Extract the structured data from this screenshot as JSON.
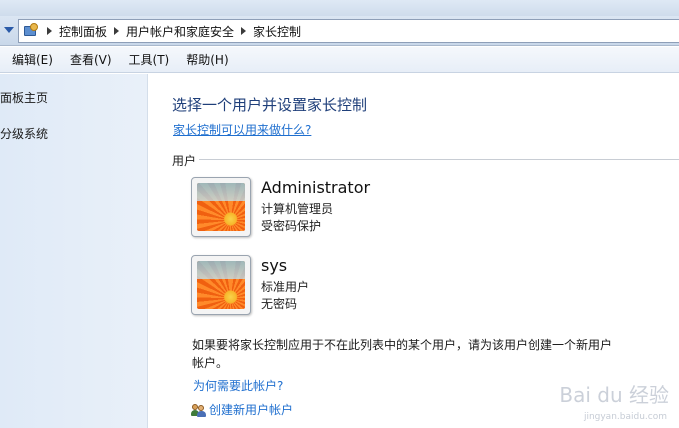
{
  "address_bar": {
    "breadcrumbs": [
      "控制面板",
      "用户帐户和家庭安全",
      "家长控制"
    ]
  },
  "menu": [
    "编辑(E)",
    "查看(V)",
    "工具(T)",
    "帮助(H)"
  ],
  "left_pane": {
    "links": [
      "面板主页",
      "分级系统"
    ]
  },
  "main": {
    "heading": "选择一个用户并设置家长控制",
    "help_link": "家长控制可以用来做什么?",
    "group_label": "用户",
    "users": [
      {
        "name": "Administrator",
        "role": "计算机管理员",
        "password": "受密码保护"
      },
      {
        "name": "sys",
        "role": "标准用户",
        "password": "无密码"
      }
    ],
    "note": "如果要将家长控制应用于不在此列表中的某个用户，请为该用户创建一个新用户帐户。",
    "why_link": "为何需要此帐户?",
    "create_link": "创建新用户帐户"
  },
  "watermark": {
    "text": "Bai du 经验",
    "url": "jingyan.baidu.com"
  },
  "icons": {
    "address_icon": "control-panel-icon",
    "create_icon": "users-icon"
  }
}
